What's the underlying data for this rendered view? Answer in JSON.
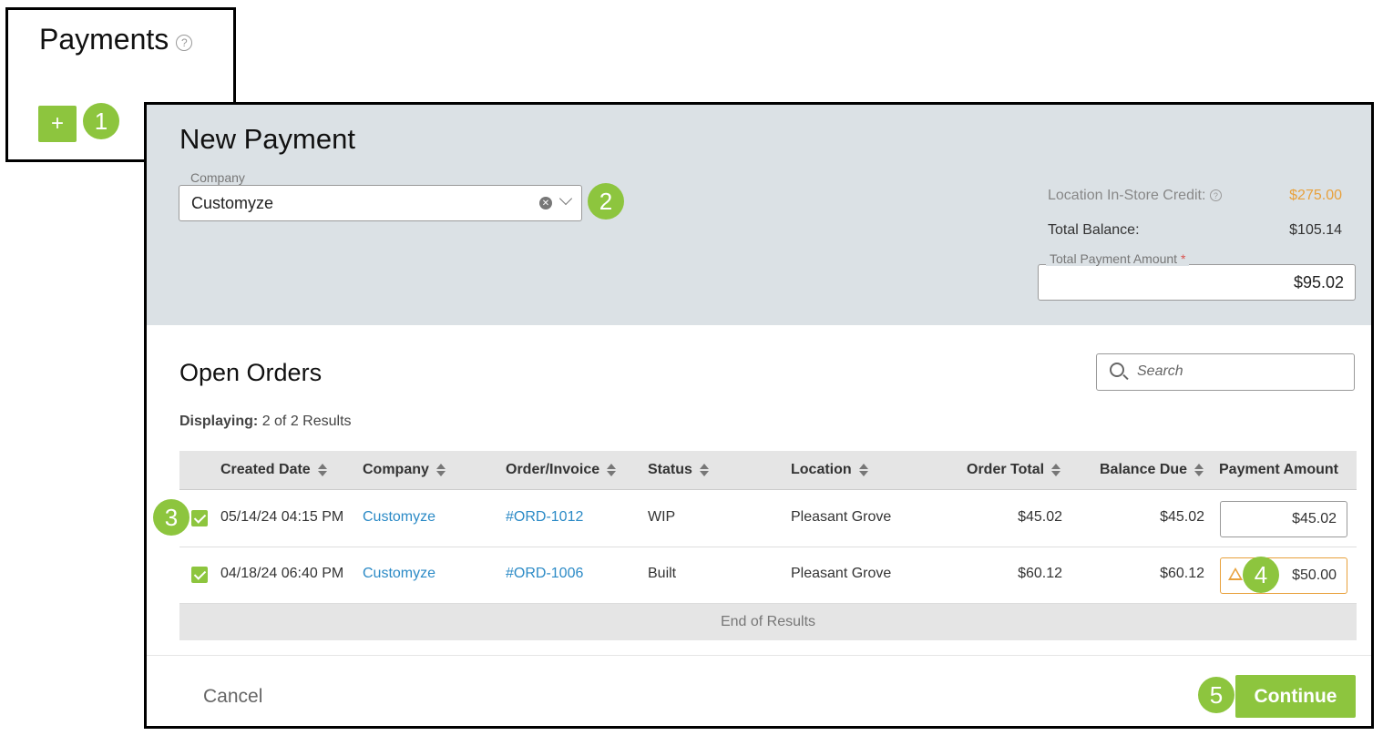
{
  "page": {
    "title": "Payments",
    "add_label": "+"
  },
  "markers": [
    "1",
    "2",
    "3",
    "4",
    "5"
  ],
  "modal": {
    "title": "New Payment",
    "company_label": "Company",
    "company_value": "Customyze",
    "credit_label": "Location In-Store Credit:",
    "credit_value": "$275.00",
    "balance_label": "Total Balance:",
    "balance_value": "$105.14",
    "payment_label": "Total Payment Amount",
    "required_mark": "*",
    "payment_value": "$95.02"
  },
  "orders": {
    "title": "Open Orders",
    "search_placeholder": "Search",
    "displaying_label": "Displaying:",
    "displaying_value": "2 of 2 Results",
    "columns": [
      "Created Date",
      "Company",
      "Order/Invoice",
      "Status",
      "Location",
      "Order Total",
      "Balance Due",
      "Payment Amount"
    ],
    "rows": [
      {
        "checked": true,
        "created": "05/14/24 04:15 PM",
        "company": "Customyze",
        "order": "#ORD-1012",
        "status": "WIP",
        "location": "Pleasant Grove",
        "total": "$45.02",
        "balance": "$45.02",
        "payment": "$45.02",
        "warning": false
      },
      {
        "checked": true,
        "created": "04/18/24 06:40 PM",
        "company": "Customyze",
        "order": "#ORD-1006",
        "status": "Built",
        "location": "Pleasant Grove",
        "total": "$60.12",
        "balance": "$60.12",
        "payment": "$50.00",
        "warning": true
      }
    ],
    "end_text": "End of Results"
  },
  "footer": {
    "cancel": "Cancel",
    "continue": "Continue"
  },
  "colors": {
    "accent": "#8dc53e",
    "credit": "#e8a13c",
    "link": "#2b8ac6",
    "header_bg": "#dbe1e5"
  }
}
